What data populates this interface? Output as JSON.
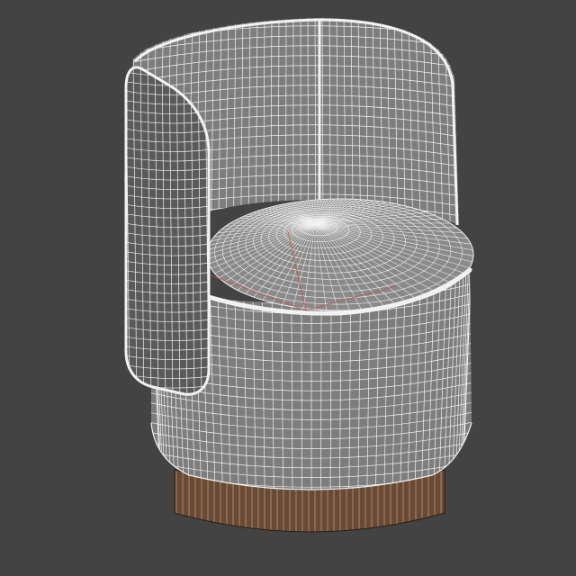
{
  "viewport": {
    "background_color": "#434343",
    "wire_color": "#f2f2f2",
    "fill_color": "#7d7d7d",
    "base_color": "#6a4a33",
    "axis_color": "#c0504d"
  },
  "model": {
    "object": "chair",
    "display_mode": "wireframe-over-shaded"
  }
}
